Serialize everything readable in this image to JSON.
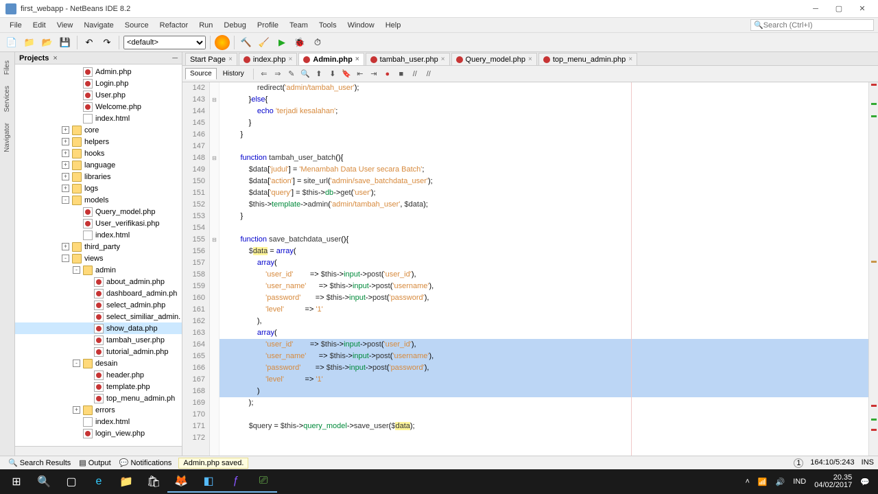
{
  "window": {
    "title": "first_webapp - NetBeans IDE 8.2"
  },
  "menu": [
    "File",
    "Edit",
    "View",
    "Navigate",
    "Source",
    "Refactor",
    "Run",
    "Debug",
    "Profile",
    "Team",
    "Tools",
    "Window",
    "Help"
  ],
  "search_placeholder": "Search (Ctrl+I)",
  "config_selected": "<default>",
  "projects_title": "Projects",
  "tree": [
    {
      "d": 5,
      "t": "",
      "i": "php",
      "n": "Admin.php"
    },
    {
      "d": 5,
      "t": "",
      "i": "php",
      "n": "Login.php"
    },
    {
      "d": 5,
      "t": "",
      "i": "php",
      "n": "User.php"
    },
    {
      "d": 5,
      "t": "",
      "i": "php",
      "n": "Welcome.php"
    },
    {
      "d": 5,
      "t": "",
      "i": "html",
      "n": "index.html"
    },
    {
      "d": 4,
      "t": "+",
      "i": "folder",
      "n": "core"
    },
    {
      "d": 4,
      "t": "+",
      "i": "folder",
      "n": "helpers"
    },
    {
      "d": 4,
      "t": "+",
      "i": "folder",
      "n": "hooks"
    },
    {
      "d": 4,
      "t": "+",
      "i": "folder",
      "n": "language"
    },
    {
      "d": 4,
      "t": "+",
      "i": "folder",
      "n": "libraries"
    },
    {
      "d": 4,
      "t": "+",
      "i": "folder",
      "n": "logs"
    },
    {
      "d": 4,
      "t": "-",
      "i": "folder",
      "n": "models"
    },
    {
      "d": 5,
      "t": "",
      "i": "php",
      "n": "Query_model.php"
    },
    {
      "d": 5,
      "t": "",
      "i": "php",
      "n": "User_verifikasi.php"
    },
    {
      "d": 5,
      "t": "",
      "i": "html",
      "n": "index.html"
    },
    {
      "d": 4,
      "t": "+",
      "i": "folder",
      "n": "third_party"
    },
    {
      "d": 4,
      "t": "-",
      "i": "folder",
      "n": "views"
    },
    {
      "d": 5,
      "t": "-",
      "i": "folder",
      "n": "admin"
    },
    {
      "d": 6,
      "t": "",
      "i": "php",
      "n": "about_admin.php"
    },
    {
      "d": 6,
      "t": "",
      "i": "php",
      "n": "dashboard_admin.ph"
    },
    {
      "d": 6,
      "t": "",
      "i": "php",
      "n": "select_admin.php"
    },
    {
      "d": 6,
      "t": "",
      "i": "php",
      "n": "select_similiar_admin."
    },
    {
      "d": 6,
      "t": "",
      "i": "php",
      "n": "show_data.php",
      "sel": true
    },
    {
      "d": 6,
      "t": "",
      "i": "php",
      "n": "tambah_user.php"
    },
    {
      "d": 6,
      "t": "",
      "i": "php",
      "n": "tutorial_admin.php"
    },
    {
      "d": 5,
      "t": "-",
      "i": "folder",
      "n": "desain"
    },
    {
      "d": 6,
      "t": "",
      "i": "php",
      "n": "header.php"
    },
    {
      "d": 6,
      "t": "",
      "i": "php",
      "n": "template.php"
    },
    {
      "d": 6,
      "t": "",
      "i": "php",
      "n": "top_menu_admin.ph"
    },
    {
      "d": 5,
      "t": "+",
      "i": "folder",
      "n": "errors"
    },
    {
      "d": 5,
      "t": "",
      "i": "html",
      "n": "index.html"
    },
    {
      "d": 5,
      "t": "",
      "i": "php",
      "n": "login_view.php"
    }
  ],
  "tabs": [
    {
      "label": "Start Page",
      "active": false,
      "icon": false
    },
    {
      "label": "index.php",
      "active": false,
      "icon": true
    },
    {
      "label": "Admin.php",
      "active": true,
      "icon": true
    },
    {
      "label": "tambah_user.php",
      "active": false,
      "icon": true
    },
    {
      "label": "Query_model.php",
      "active": false,
      "icon": true
    },
    {
      "label": "top_menu_admin.php",
      "active": false,
      "icon": true
    }
  ],
  "source_tab": "Source",
  "history_tab": "History",
  "code_start": 142,
  "code_lines": [
    {
      "h": "<span>                <span class='fn'>redirect</span>(<span class='str'>'admin/tambah_user'</span>);</span>"
    },
    {
      "h": "<span>            }<span class='kw'>else</span>{</span>",
      "fold": "-"
    },
    {
      "h": "<span>                <span class='kw'>echo</span> <span class='str'>'terjadi kesalahan'</span>;</span>"
    },
    {
      "h": "<span>            }</span>"
    },
    {
      "h": "<span>        }</span>"
    },
    {
      "h": "<span></span>"
    },
    {
      "h": "<span>        <span class='kw'>function</span> <span class='fn'>tambah_user_batch</span>(){</span>",
      "fold": "-"
    },
    {
      "h": "<span>            <span class='var'>$data</span>[<span class='str'>'judul'</span>] = <span class='str'>'Menambah Data User secara Batch'</span>;</span>"
    },
    {
      "h": "<span>            <span class='var'>$data</span>[<span class='str'>'action'</span>] = <span class='fn'>site_url</span>(<span class='str'>'admin/save_batchdata_user'</span>);</span>"
    },
    {
      "h": "<span>            <span class='var'>$data</span>[<span class='str'>'query'</span>] = <span class='var'>$this</span>-&gt;<span class='prop'>db</span>-&gt;<span class='fn'>get</span>(<span class='str'>'user'</span>);</span>"
    },
    {
      "h": "<span>            <span class='var'>$this</span>-&gt;<span class='prop'>template</span>-&gt;<span class='fn'>admin</span>(<span class='str'>'admin/tambah_user'</span>, <span class='var'>$data</span>);</span>"
    },
    {
      "h": "<span>        }</span>"
    },
    {
      "h": "<span></span>"
    },
    {
      "h": "<span>        <span class='kw'>function</span> <span class='fn'>save_batchdata_user</span>(){</span>",
      "fold": "-"
    },
    {
      "h": "<span>            <span class='var'>$<span class='hi'>data</span></span> = <span class='kw'>array</span>(</span>"
    },
    {
      "h": "<span>                <span class='kw'>array</span>(</span>"
    },
    {
      "h": "<span>                    <span class='str'>'user_id'</span>        =&gt; <span class='var'>$this</span>-&gt;<span class='prop'>input</span>-&gt;<span class='fn'>post</span>(<span class='str'>'user_id'</span>),</span>"
    },
    {
      "h": "<span>                    <span class='str'>'user_name'</span>      =&gt; <span class='var'>$this</span>-&gt;<span class='prop'>input</span>-&gt;<span class='fn'>post</span>(<span class='str'>'username'</span>),</span>"
    },
    {
      "h": "<span>                    <span class='str'>'password'</span>       =&gt; <span class='var'>$this</span>-&gt;<span class='prop'>input</span>-&gt;<span class='fn'>post</span>(<span class='str'>'password'</span>),</span>"
    },
    {
      "h": "<span>                    <span class='str'>'level'</span>          =&gt; <span class='str'>'1'</span></span>"
    },
    {
      "h": "<span>                ),</span>"
    },
    {
      "h": "<span>                <span class='kw'>array</span>(</span>"
    },
    {
      "h": "<span>                    <span class='str'>'user_id'</span>        =&gt; <span class='var'>$this</span>-&gt;<span class='prop'>input</span>-&gt;<span class='fn'>post</span>(<span class='str'>'user_id'</span>),</span>",
      "hl": true
    },
    {
      "h": "<span>                    <span class='str'>'user_name'</span>      =&gt; <span class='var'>$this</span>-&gt;<span class='prop'>input</span>-&gt;<span class='fn'>post</span>(<span class='str'>'username'</span>),</span>",
      "hl": true
    },
    {
      "h": "<span>                    <span class='str'>'password'</span>       =&gt; <span class='var'>$this</span>-&gt;<span class='prop'>input</span>-&gt;<span class='fn'>post</span>(<span class='str'>'password'</span>),</span>",
      "hl": true
    },
    {
      "h": "<span>                    <span class='str'>'level'</span>          =&gt; <span class='str'>'1'</span></span>",
      "hl": true
    },
    {
      "h": "<span>                )</span>",
      "hl": true
    },
    {
      "h": "<span>            );</span>"
    },
    {
      "h": "<span></span>"
    },
    {
      "h": "<span>            <span class='var'>$query</span> = <span class='var'>$this</span>-&gt;<span class='prop'>query_model</span>-&gt;<span class='fn'>save_user</span>(<span class='var'>$<span class='hi'>data</span></span>);</span>"
    },
    {
      "h": "<span></span>"
    }
  ],
  "status": {
    "search_results": "Search Results",
    "output": "Output",
    "notifications": "Notifications",
    "saved": "Admin.php saved.",
    "badge": "1",
    "pos": "164:10/5:243",
    "ins": "INS"
  },
  "tray": {
    "lang": "IND",
    "time": "20.35",
    "date": "04/02/2017"
  },
  "sidebar_tabs": [
    "Files",
    "Services",
    "Navigator"
  ]
}
